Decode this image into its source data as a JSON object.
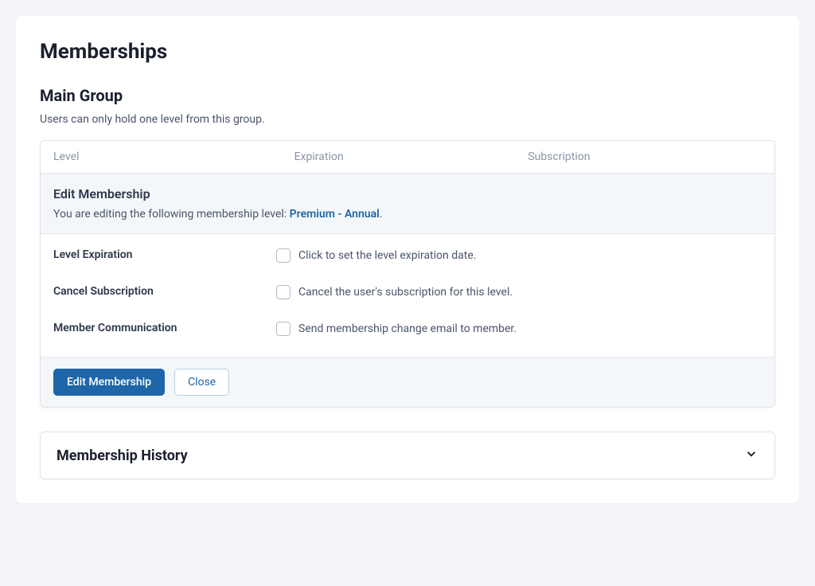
{
  "page": {
    "title": "Memberships"
  },
  "group": {
    "title": "Main Group",
    "description": "Users can only hold one level from this group."
  },
  "table": {
    "headers": {
      "level": "Level",
      "expiration": "Expiration",
      "subscription": "Subscription"
    }
  },
  "edit": {
    "title": "Edit Membership",
    "subtitle_prefix": "You are editing the following membership level: ",
    "level_name": "Premium - Annual",
    "subtitle_suffix": ".",
    "rows": {
      "expiration": {
        "label": "Level Expiration",
        "text": "Click to set the level expiration date."
      },
      "cancel": {
        "label": "Cancel Subscription",
        "text": "Cancel the user's subscription for this level."
      },
      "communication": {
        "label": "Member Communication",
        "text": "Send membership change email to member."
      }
    },
    "buttons": {
      "save": "Edit Membership",
      "close": "Close"
    }
  },
  "history": {
    "title": "Membership History"
  }
}
